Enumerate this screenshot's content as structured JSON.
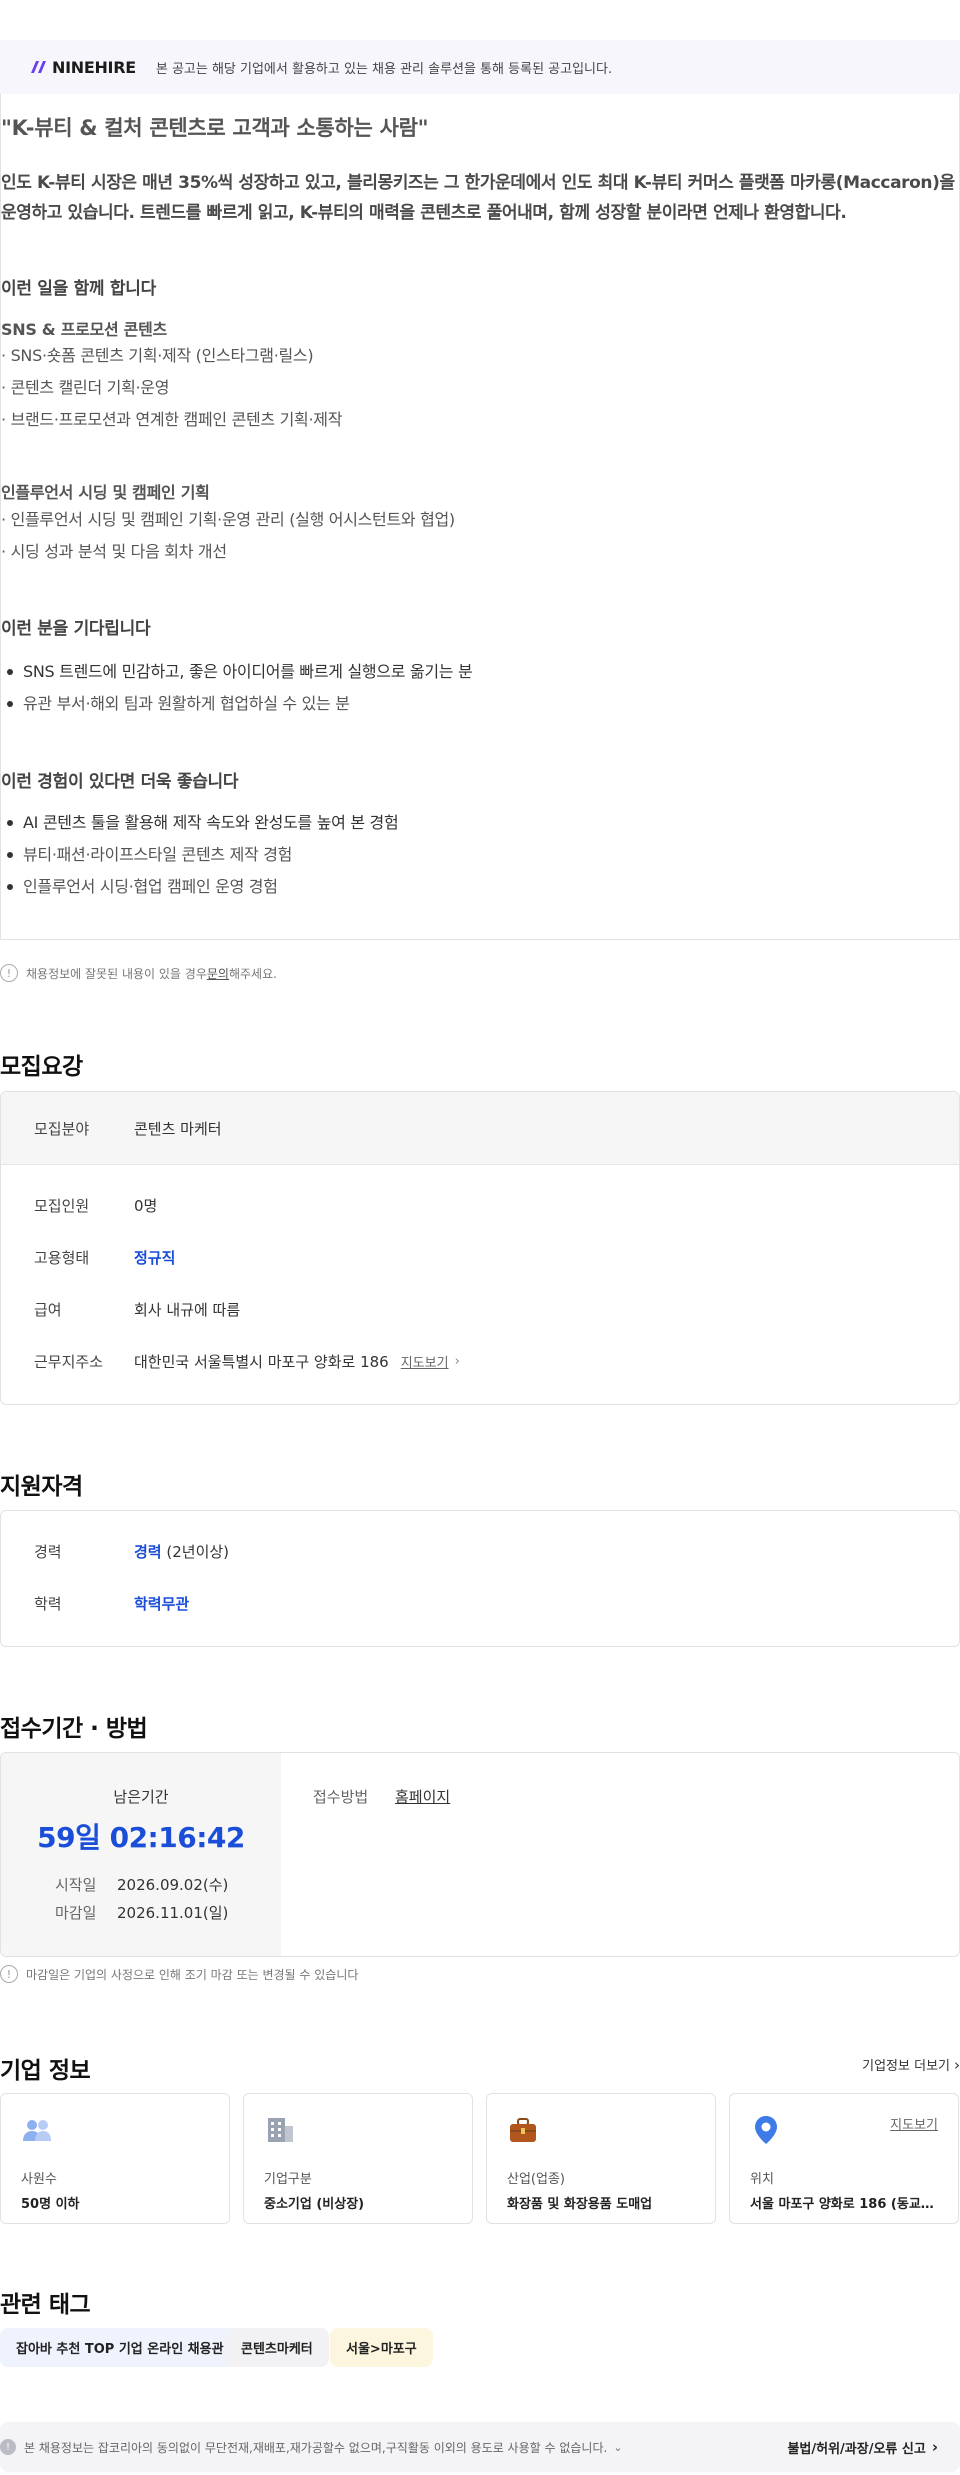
{
  "banner": {
    "logo": "NINEHIRE",
    "notice": "본 공고는 해당 기업에서 활용하고 있는 채용 관리 솔루션을 통해 등록된 공고입니다."
  },
  "jd": {
    "title": "\"K-뷰티 & 컬처 콘텐츠로 고객과 소통하는 사람\"",
    "intro_1": "인도 K-뷰티 시장은 매년 35%씩 성장하고 있고, 블리몽키즈는 그 한가운데에서 인도 최대 K-뷰티 커머스 플랫폼 마카롱(Maccaron)을",
    "intro_2": "운영하고 있습니다. 트렌드를 빠르게 읽고, K-뷰티의 매력을 콘텐츠로 풀어내며, 함께 성장할 분이라면 언제나 환영합니다.",
    "work_heading": "이런 일을 함께 합니다",
    "sns_heading": "SNS & 프로모션 콘텐츠",
    "sns_items": [
      "· SNS·숏폼 콘텐츠 기획·제작 (인스타그램·릴스)",
      "· 콘텐츠 캘린더 기획·운영",
      "· 브랜드·프로모션과 연계한 캠페인 콘텐츠 기획·제작"
    ],
    "influencer_heading": "인플루언서 시딩 및 캠페인 기획",
    "influencer_items": [
      "· 인플루언서 시딩 및 캠페인 기획·운영 관리 (실행 어시스턴트와 협업)",
      "· 시딩 성과 분석 및 다음 회차 개선"
    ],
    "wait_heading": "이런 분을 기다립니다",
    "wait_items": [
      "SNS 트렌드에 민감하고, 좋은 아이디어를 빠르게 실행으로 옮기는 분",
      "유관 부서·해외 팀과 원활하게 협업하실 수 있는 분"
    ],
    "plus_heading": "이런 경험이 있다면 더욱 좋습니다",
    "plus_items": [
      "AI 콘텐츠 툴을 활용해 제작 속도와 완성도를 높여 본 경험",
      "뷰티·패션·라이프스타일 콘텐츠 제작 경험",
      "인플루언서 시딩·협업 캠페인 운영 경험"
    ]
  },
  "report": {
    "prefix": "채용정보에 잘못된 내용이 있을 경우 ",
    "link": "문의",
    "suffix": "해주세요."
  },
  "recruitment": {
    "title": "모집요강",
    "field_label": "모집분야",
    "field_value": "콘텐츠 마케터",
    "headcount_label": "모집인원",
    "headcount_value": "0명",
    "employment_label": "고용형태",
    "employment_value": "정규직",
    "salary_label": "급여",
    "salary_value": "회사 내규에 따름",
    "address_label": "근무지주소",
    "address_value": "대한민국 서울특별시 마포구 양화로 186",
    "map_link": "지도보기"
  },
  "qualification": {
    "title": "지원자격",
    "career_label": "경력",
    "career_value": "경력",
    "career_detail": " (2년이상)",
    "education_label": "학력",
    "education_value": "학력무관"
  },
  "period": {
    "title": "접수기간 · 방법",
    "remaining_label": "남은기간",
    "countdown": "59일 02:16:42",
    "start_label": "시작일",
    "start_value": "2026.09.02(수)",
    "end_label": "마감일",
    "end_value": "2026.11.01(일)",
    "method_label": "접수방법",
    "method_value": "홈페이지",
    "deadline_note": "마감일은 기업의 사정으로 인해 조기 마감 또는 변경될 수 있습니다"
  },
  "company": {
    "title": "기업 정보",
    "more_link": "기업정보 더보기",
    "cards": [
      {
        "icon": "people-icon",
        "label": "사원수",
        "value": "50명 이하"
      },
      {
        "icon": "building-icon",
        "label": "기업구분",
        "value": "중소기업 (비상장)"
      },
      {
        "icon": "briefcase-icon",
        "label": "산업(업종)",
        "value": "화장품 및 화장용품 도매업"
      },
      {
        "icon": "location-pin-icon",
        "label": "위치",
        "value": "서울 마포구 양화로 186 (동교동...",
        "map_link": "지도보기"
      }
    ]
  },
  "tags": {
    "title": "관련 태그",
    "items": [
      "잡아바 추천 TOP 기업 온라인 채용관",
      "콘텐츠마케터",
      "서울>마포구"
    ]
  },
  "footer": {
    "notice": "본 채용정보는 잡코리아의 동의없이 무단전재,재배포,재가공할수 없으며,구직활동 이외의 용도로 사용할 수 없습니다.",
    "report": "불법/허위/과장/오류 신고"
  },
  "colors": {
    "accent_blue": "#1a4dd8",
    "logo_purple": "#6b3df0",
    "tag_blue_bg": "#eef3fd",
    "tag_gray_bg": "#f2f2f4",
    "tag_yellow_bg": "#fdf6de"
  }
}
